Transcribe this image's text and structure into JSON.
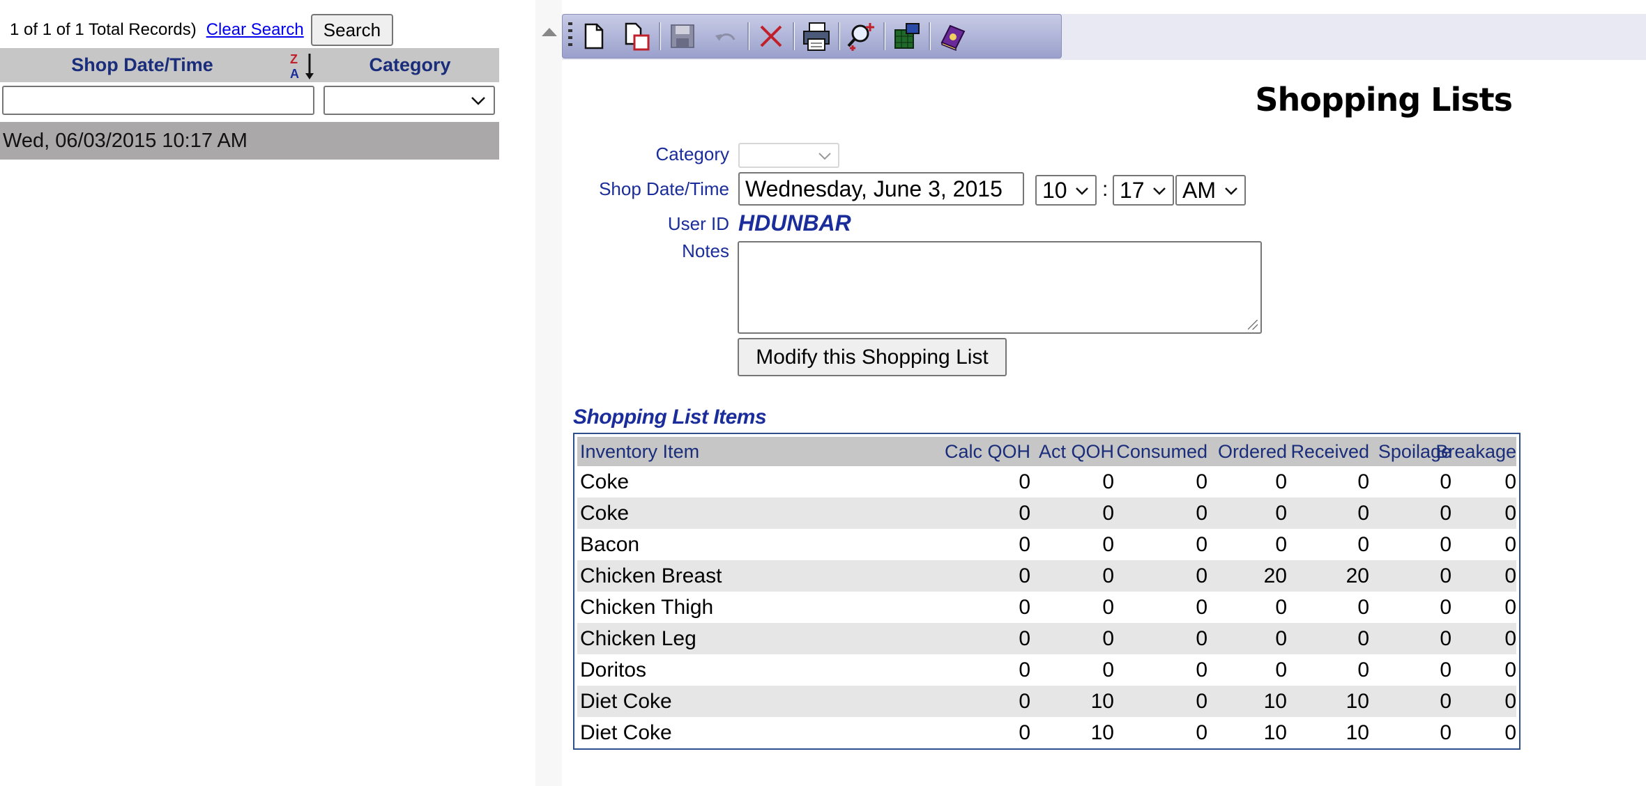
{
  "left": {
    "record_count": "1 of 1 of 1 Total Records)",
    "clear_search": "Clear Search",
    "search_button": "Search",
    "columns": [
      "Shop Date/Time",
      "Category"
    ],
    "rows": [
      "Wed, 06/03/2015 10:17 AM"
    ]
  },
  "form": {
    "title": "Shopping Lists",
    "category_label": "Category",
    "category_value": "",
    "shop_date_label": "Shop Date/Time",
    "shop_date_value": "Wednesday, June 3, 2015",
    "hour": "10",
    "colon": ":",
    "minute": "17",
    "ampm": "AM",
    "user_id_label": "User ID",
    "user_id_value": "HDUNBAR",
    "notes_label": "Notes",
    "notes_value": "",
    "modify_button": "Modify this Shopping List"
  },
  "toolbar": {
    "icons": [
      "new-icon",
      "copy-icon",
      "save-icon",
      "undo-icon",
      "delete-icon",
      "print-icon",
      "find-icon",
      "export-icon",
      "help-book-icon"
    ]
  },
  "items": {
    "header": "Shopping List Items",
    "columns": [
      "Inventory Item",
      "Calc QOH",
      "Act QOH",
      "Consumed",
      "Ordered",
      "Received",
      "Spoilage",
      "Breakage"
    ],
    "rows": [
      [
        "Coke",
        "0",
        "0",
        "0",
        "0",
        "0",
        "0",
        "0"
      ],
      [
        "Coke",
        "0",
        "0",
        "0",
        "0",
        "0",
        "0",
        "0"
      ],
      [
        "Bacon",
        "0",
        "0",
        "0",
        "0",
        "0",
        "0",
        "0"
      ],
      [
        "Chicken Breast",
        "0",
        "0",
        "0",
        "20",
        "20",
        "0",
        "0"
      ],
      [
        "Chicken Thigh",
        "0",
        "0",
        "0",
        "0",
        "0",
        "0",
        "0"
      ],
      [
        "Chicken Leg",
        "0",
        "0",
        "0",
        "0",
        "0",
        "0",
        "0"
      ],
      [
        "Doritos",
        "0",
        "0",
        "0",
        "0",
        "0",
        "0",
        "0"
      ],
      [
        "Diet Coke",
        "0",
        "10",
        "0",
        "10",
        "10",
        "0",
        "0"
      ],
      [
        "Diet Coke",
        "0",
        "10",
        "0",
        "10",
        "10",
        "0",
        "0"
      ]
    ]
  },
  "colors": {
    "label": "#1a2d9a",
    "header_bg": "#c6c6c6",
    "alt_row": "#e6e6e6",
    "selected_row": "#aaa8a8"
  }
}
